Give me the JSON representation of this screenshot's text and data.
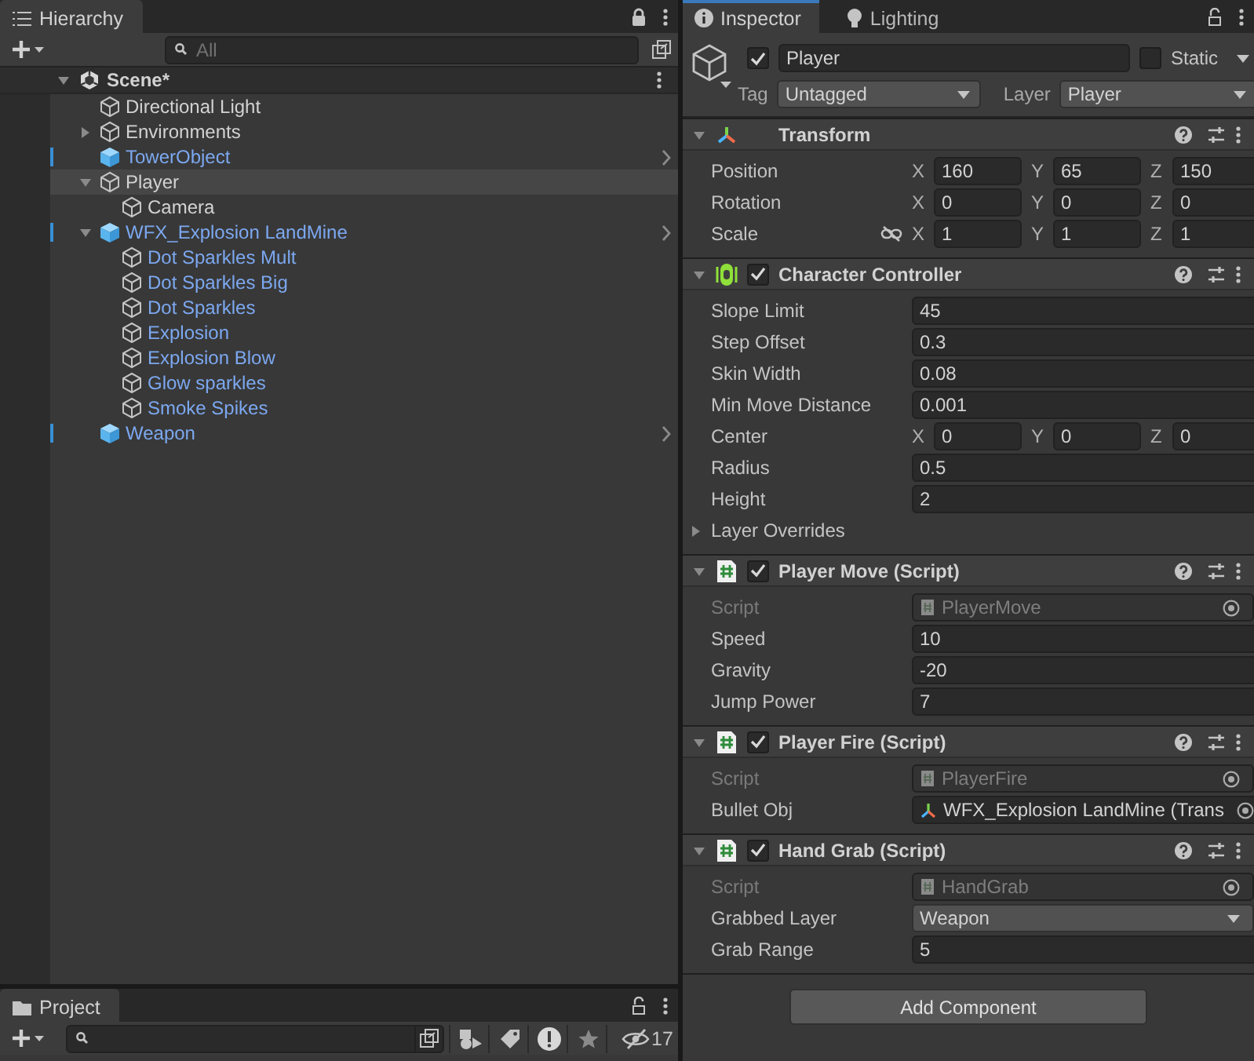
{
  "hierarchy": {
    "focused": false,
    "locked": true,
    "tabs": [
      {
        "label": "Hierarchy",
        "selected": true
      }
    ],
    "search": {
      "placeholder": "All"
    },
    "scene": {
      "name": "Scene*",
      "expanded": true,
      "children": [
        {
          "name": "Directional Light",
          "kind": "object",
          "selected": false
        },
        {
          "name": "Environments",
          "kind": "object",
          "expanded": false,
          "selected": false
        },
        {
          "name": "TowerObject",
          "kind": "prefab_root",
          "selected": false
        },
        {
          "name": "Player",
          "kind": "object",
          "expanded": true,
          "selected": true,
          "children": [
            {
              "name": "Camera",
              "kind": "object",
              "selected": false
            }
          ]
        },
        {
          "name": "WFX_Explosion LandMine",
          "kind": "prefab_root",
          "expanded": true,
          "selected": false,
          "children": [
            {
              "name": "Dot Sparkles Mult",
              "kind": "prefab_child",
              "selected": false
            },
            {
              "name": "Dot Sparkles Big",
              "kind": "prefab_child",
              "selected": false
            },
            {
              "name": "Dot Sparkles",
              "kind": "prefab_child",
              "selected": false
            },
            {
              "name": "Explosion",
              "kind": "prefab_child",
              "selected": false
            },
            {
              "name": "Explosion Blow",
              "kind": "prefab_child",
              "selected": false
            },
            {
              "name": "Glow sparkles",
              "kind": "prefab_child",
              "selected": false
            },
            {
              "name": "Smoke Spikes",
              "kind": "prefab_child",
              "selected": false
            }
          ]
        },
        {
          "name": "Weapon",
          "kind": "prefab_root",
          "selected": false
        }
      ]
    }
  },
  "inspector": {
    "focused": true,
    "locked": false,
    "tabs": [
      {
        "label": "Inspector",
        "selected": true
      },
      {
        "label": "Lighting",
        "selected": false
      }
    ],
    "object": {
      "active": true,
      "name": "Player",
      "static": false,
      "static_label": "Static",
      "tag_label": "Tag",
      "tag": "Untagged",
      "layer_label": "Layer",
      "layer": "Player"
    },
    "components": [
      {
        "title": "Transform",
        "kind": "transform",
        "expanded": true,
        "fields": [
          {
            "kind": "vector3",
            "label": "Position",
            "axes": [
              {
                "axis": "X",
                "value": "160"
              },
              {
                "axis": "Y",
                "value": "65"
              },
              {
                "axis": "Z",
                "value": "150"
              }
            ]
          },
          {
            "kind": "vector3",
            "label": "Rotation",
            "axes": [
              {
                "axis": "X",
                "value": "0"
              },
              {
                "axis": "Y",
                "value": "0"
              },
              {
                "axis": "Z",
                "value": "0"
              }
            ]
          },
          {
            "kind": "vector3",
            "label": "Scale",
            "proportional": false,
            "axes": [
              {
                "axis": "X",
                "value": "1"
              },
              {
                "axis": "Y",
                "value": "1"
              },
              {
                "axis": "Z",
                "value": "1"
              }
            ]
          }
        ]
      },
      {
        "title": "Character Controller",
        "kind": "character",
        "enabled": true,
        "expanded": true,
        "fields": [
          {
            "kind": "number",
            "label": "Slope Limit",
            "value": "45"
          },
          {
            "kind": "number",
            "label": "Step Offset",
            "value": "0.3"
          },
          {
            "kind": "number",
            "label": "Skin Width",
            "value": "0.08"
          },
          {
            "kind": "number",
            "label": "Min Move Distance",
            "value": "0.001"
          },
          {
            "kind": "vector3",
            "label": "Center",
            "axes": [
              {
                "axis": "X",
                "value": "0"
              },
              {
                "axis": "Y",
                "value": "0"
              },
              {
                "axis": "Z",
                "value": "0"
              }
            ]
          },
          {
            "kind": "number",
            "label": "Radius",
            "value": "0.5"
          },
          {
            "kind": "number",
            "label": "Height",
            "value": "2"
          },
          {
            "kind": "foldout",
            "label": "Layer Overrides",
            "expanded": false
          }
        ]
      },
      {
        "title": "Player Move (Script)",
        "kind": "script",
        "enabled": true,
        "expanded": true,
        "fields": [
          {
            "kind": "script_ref",
            "label": "Script",
            "value": "PlayerMove",
            "disabled": true
          },
          {
            "kind": "number",
            "label": "Speed",
            "value": "10"
          },
          {
            "kind": "number",
            "label": "Gravity",
            "value": "-20"
          },
          {
            "kind": "number",
            "label": "Jump Power",
            "value": "7"
          }
        ]
      },
      {
        "title": "Player Fire (Script)",
        "kind": "script",
        "enabled": true,
        "expanded": true,
        "fields": [
          {
            "kind": "script_ref",
            "label": "Script",
            "value": "PlayerFire",
            "disabled": true
          },
          {
            "kind": "transform_ref",
            "label": "Bullet Obj",
            "value": "WFX_Explosion LandMine (Trans",
            "disabled": false
          }
        ]
      },
      {
        "title": "Hand Grab (Script)",
        "kind": "script",
        "enabled": true,
        "expanded": true,
        "fields": [
          {
            "kind": "script_ref",
            "label": "Script",
            "value": "HandGrab",
            "disabled": true
          },
          {
            "kind": "dropdown",
            "label": "Grabbed Layer",
            "value": "Weapon"
          },
          {
            "kind": "number",
            "label": "Grab Range",
            "value": "5"
          }
        ]
      }
    ],
    "add_button": "Add Component"
  },
  "project": {
    "focused": false,
    "locked": false,
    "tabs": [
      {
        "label": "Project",
        "selected": true
      }
    ],
    "hidden_count": "17"
  }
}
